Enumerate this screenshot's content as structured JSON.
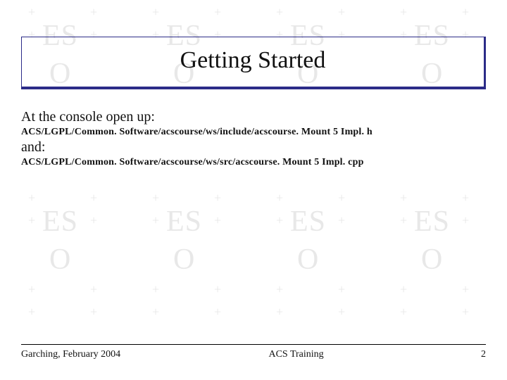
{
  "title": "Getting Started",
  "body": {
    "line1": "At the console open up:",
    "path1": "ACS/LGPL/Common. Software/acscourse/ws/include/acscourse. Mount 5 Impl. h",
    "line2": "and:",
    "path2": "ACS/LGPL/Common. Software/acscourse/ws/src/acscourse. Mount 5 Impl. cpp"
  },
  "footer": {
    "left": "Garching, February 2004",
    "center": "ACS Training",
    "right": "2"
  },
  "watermark": {
    "plus": "+",
    "es": "ES",
    "o": "O"
  }
}
